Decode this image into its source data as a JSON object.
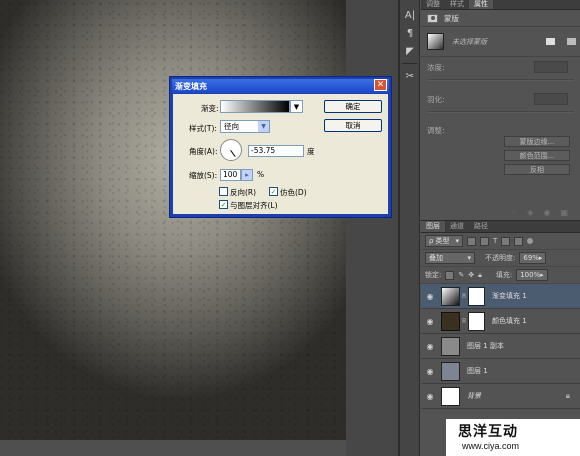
{
  "dialog": {
    "title": "渐变填充",
    "gradient_label": "渐变:",
    "style_label": "样式(T):",
    "style_value": "径向",
    "angle_label": "角度(A):",
    "angle_value": "-53.75",
    "angle_unit": "度",
    "scale_label": "缩放(S):",
    "scale_value": "100",
    "scale_unit": "%",
    "reverse_label": "反向(R)",
    "dither_label": "仿色(D)",
    "align_label": "与图层对齐(L)",
    "reverse_checked": false,
    "dither_checked": true,
    "align_checked": true,
    "ok_label": "确定",
    "cancel_label": "取消"
  },
  "top_panel": {
    "tabs": [
      "调整",
      "样式",
      "属性"
    ],
    "header_title": "蒙版",
    "mask_note": "未选择蒙版",
    "density_label": "浓度:",
    "feather_label": "羽化:",
    "adjust_label": "调整:",
    "buttons": [
      "蒙版边缘...",
      "颜色范围...",
      "反相"
    ]
  },
  "layers_panel": {
    "tabs": [
      "图层",
      "通道",
      "路径"
    ],
    "filter_value": "类型",
    "blend_mode": "叠加",
    "opacity_label": "不透明度:",
    "opacity_value": "69%",
    "lock_label": "锁定:",
    "fill_label": "填充:",
    "fill_value": "100%",
    "layers": [
      {
        "name": "渐变填充 1",
        "selected": true
      },
      {
        "name": "颜色填充 1",
        "selected": false
      },
      {
        "name": "图层 1 副本",
        "selected": false
      },
      {
        "name": "图层 1",
        "selected": false
      },
      {
        "name": "背景",
        "selected": false
      }
    ]
  },
  "watermark": {
    "title": "思洋互动",
    "url": "www.ciya.com"
  },
  "colors": {
    "panel_bg": "#535353",
    "selected_layer": "#4b5b70",
    "dialog_frame": "#1e3fae"
  }
}
